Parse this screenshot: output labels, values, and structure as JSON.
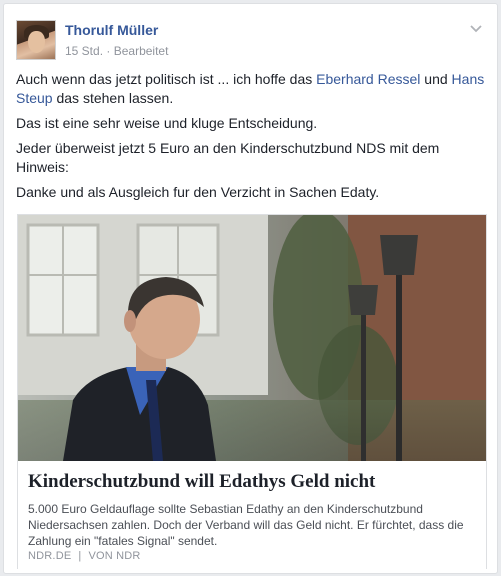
{
  "post": {
    "author": {
      "name": "Thorulf Müller"
    },
    "meta": {
      "time": "15 Std.",
      "separator": "·",
      "edited": "Bearbeitet"
    },
    "text": {
      "line1_a": "Auch wenn das jetzt politisch ist ... ich hoffe das ",
      "mention1": "Eberhard Ressel",
      "line1_b": " und ",
      "mention2": "Hans Steup",
      "line1_c": " das stehen lassen.",
      "p2": "Das ist eine sehr weise und kluge Entscheidung.",
      "p3": "Jeder überweist jetzt 5 Euro an den Kinderschutzbund NDS mit dem Hinweis:",
      "p4": "Danke und als Ausgleich fur den Verzicht in Sachen Edaty."
    },
    "link": {
      "title": "Kinderschutzbund will Edathys Geld nicht",
      "description": "5.000 Euro Geldauflage sollte Sebastian Edathy an den Kinderschutzbund Niedersachsen zahlen. Doch der Verband will das Geld nicht. Er fürchtet, dass die Zahlung ein \"fatales Signal\" sendet.",
      "domain": "NDR.DE",
      "separator": "|",
      "by": "VON NDR"
    }
  },
  "icons": {
    "menu": "chevron-down-icon"
  },
  "colors": {
    "link_blue": "#365899",
    "meta_gray": "#90949c",
    "background": "#e9ebee"
  }
}
